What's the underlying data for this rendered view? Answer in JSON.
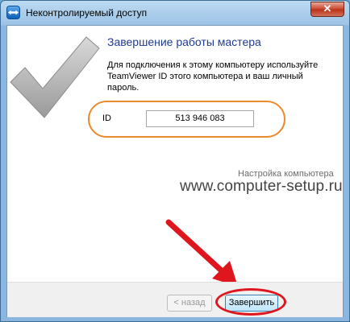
{
  "window": {
    "title": "Неконтролируемый доступ",
    "close_label": "✕",
    "app_icon": "teamviewer-icon"
  },
  "wizard": {
    "heading": "Завершение работы мастера",
    "description": "Для подключения к этому компьютеру используйте TeamViewer ID этого компьютера и ваш личный пароль.",
    "id_label": "ID",
    "id_value": "513 946 083"
  },
  "watermark": {
    "small": "Настройка компьютера",
    "big": "www.computer-setup.ru"
  },
  "buttons": {
    "back_label": "< назад",
    "finish_label": "Завершить"
  },
  "annotations": {
    "highlight_color": "#ef8a2c",
    "arrow_color": "#e0161e"
  }
}
